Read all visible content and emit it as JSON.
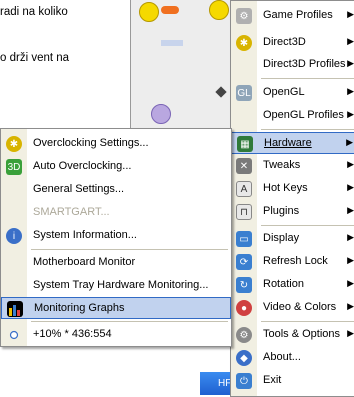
{
  "background": {
    "line1": "radi na koliko",
    "line2": "o drži vent na",
    "taskbar_text": "HF"
  },
  "right_menu": {
    "items": [
      {
        "label": "Game Profiles",
        "icon": "game-profiles-icon",
        "submenu": true
      },
      {
        "label": "Direct3D",
        "icon": "direct3d-icon",
        "submenu": true
      },
      {
        "label": "Direct3D Profiles",
        "icon": "",
        "submenu": true
      },
      {
        "label": "OpenGL",
        "icon": "opengl-icon",
        "submenu": true
      },
      {
        "label": "OpenGL Profiles",
        "icon": "",
        "submenu": true
      },
      {
        "label": "Hardware",
        "icon": "hardware-icon",
        "submenu": true,
        "highlighted": true
      },
      {
        "label": "Tweaks",
        "icon": "tweaks-icon",
        "submenu": true
      },
      {
        "label": "Hot Keys",
        "icon": "hot-keys-icon",
        "submenu": true
      },
      {
        "label": "Plugins",
        "icon": "plugins-icon",
        "submenu": true
      },
      {
        "label": "Display",
        "icon": "display-icon",
        "submenu": true
      },
      {
        "label": "Refresh Lock",
        "icon": "refresh-lock-icon",
        "submenu": true
      },
      {
        "label": "Rotation",
        "icon": "rotation-icon",
        "submenu": true
      },
      {
        "label": "Video & Colors",
        "icon": "video-colors-icon",
        "submenu": true
      },
      {
        "label": "Tools & Options",
        "icon": "tools-options-icon",
        "submenu": true
      },
      {
        "label": "About...",
        "icon": "about-icon",
        "submenu": false
      },
      {
        "label": "Exit",
        "icon": "exit-icon",
        "submenu": false
      }
    ]
  },
  "left_menu": {
    "items": [
      {
        "label": "Overclocking Settings...",
        "icon": "overclocking-icon"
      },
      {
        "label": "Auto Overclocking...",
        "icon": "auto-overclocking-icon"
      },
      {
        "label": "General Settings...",
        "icon": ""
      },
      {
        "label": "SMARTGART...",
        "icon": "",
        "disabled": true
      },
      {
        "label": "System Information...",
        "icon": "info-icon"
      },
      {
        "label": "Motherboard Monitor",
        "icon": ""
      },
      {
        "label": "System Tray Hardware Monitoring...",
        "icon": ""
      },
      {
        "label": "Monitoring Graphs",
        "icon": "monitoring-graphs-icon",
        "highlighted": true
      },
      {
        "label": "+10% * 436:554",
        "icon": "radio-icon"
      }
    ]
  }
}
